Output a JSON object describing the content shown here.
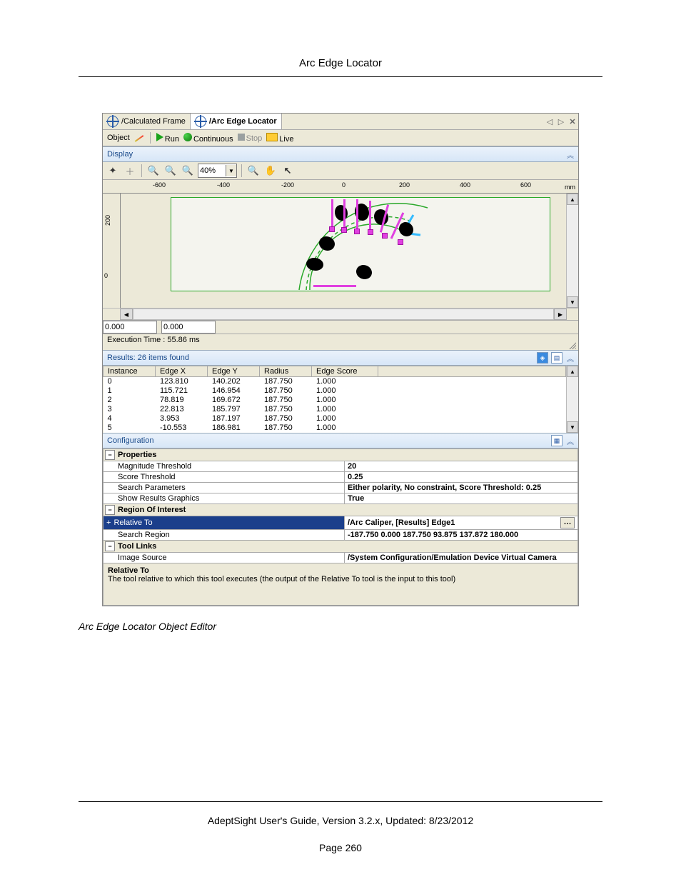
{
  "page": {
    "title": "Arc Edge Locator",
    "caption": "Arc Edge Locator Object Editor",
    "footer_line": "AdeptSight User's Guide,  Version 3.2.x, Updated: 8/23/2012",
    "page_num": "Page 260"
  },
  "crumb": {
    "item1": "/Calculated Frame",
    "item2": "/Arc Edge Locator"
  },
  "runbar": {
    "object": "Object",
    "run": "Run",
    "continuous": "Continuous",
    "stop": "Stop",
    "live": "Live"
  },
  "display": {
    "header": "Display",
    "zoom": "40%",
    "ruler": {
      "t_m600": "-600",
      "t_m400": "-400",
      "t_m200": "-200",
      "t_0": "0",
      "t_200": "200",
      "t_400": "400",
      "t_600": "600",
      "unit": "mm",
      "v_200": "200",
      "v_0": "0"
    },
    "coord_x": "0.000",
    "coord_y": "0.000",
    "exec": "Execution Time : 55.86 ms"
  },
  "results": {
    "header": "Results: 26 items found",
    "cols": {
      "instance": "Instance",
      "edgex": "Edge X",
      "edgey": "Edge Y",
      "radius": "Radius",
      "score": "Edge Score"
    },
    "rows": [
      {
        "i": "0",
        "x": "123.810",
        "y": "140.202",
        "r": "187.750",
        "s": "1.000"
      },
      {
        "i": "1",
        "x": "115.721",
        "y": "146.954",
        "r": "187.750",
        "s": "1.000"
      },
      {
        "i": "2",
        "x": "78.819",
        "y": "169.672",
        "r": "187.750",
        "s": "1.000"
      },
      {
        "i": "3",
        "x": "22.813",
        "y": "185.797",
        "r": "187.750",
        "s": "1.000"
      },
      {
        "i": "4",
        "x": "3.953",
        "y": "187.197",
        "r": "187.750",
        "s": "1.000"
      },
      {
        "i": "5",
        "x": "-10.553",
        "y": "186.981",
        "r": "187.750",
        "s": "1.000"
      }
    ]
  },
  "config": {
    "header": "Configuration",
    "groups": {
      "properties": "Properties",
      "roi": "Region Of Interest",
      "tool": "Tool Links"
    },
    "props": {
      "mag_k": "Magnitude Threshold",
      "mag_v": "20",
      "score_k": "Score Threshold",
      "score_v": "0.25",
      "search_k": "Search Parameters",
      "search_v": "Either polarity, No constraint, Score Threshold: 0.25",
      "show_k": "Show Results Graphics",
      "show_v": "True"
    },
    "roi": {
      "rel_k": "Relative To",
      "rel_v": "/Arc Caliper, [Results] Edge1",
      "reg_k": "Search Region",
      "reg_v": "-187.750 0.000 187.750 93.875 137.872 180.000"
    },
    "tool": {
      "img_k": "Image Source",
      "img_v": "/System Configuration/Emulation Device Virtual Camera"
    },
    "desc": {
      "title": "Relative To",
      "body": "The tool relative to which this tool executes (the output of the Relative To tool is the input to this tool)"
    }
  }
}
